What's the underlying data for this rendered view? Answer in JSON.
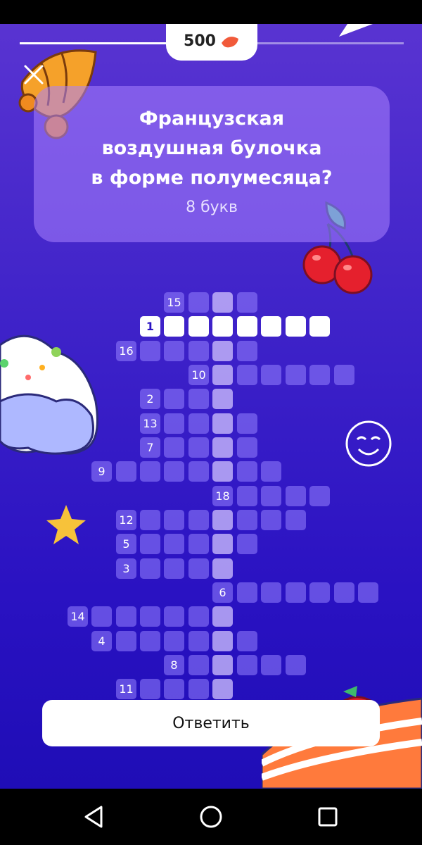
{
  "header": {
    "score": "500",
    "score_icon": "croissant-icon"
  },
  "question": {
    "text": "Французская\nвоздушная булочка\nв форме полумесяца?",
    "letters": "8 букв"
  },
  "crossword": {
    "numbers": [
      "15",
      "1",
      "16",
      "10",
      "2",
      "13",
      "7",
      "9",
      "18",
      "12",
      "5",
      "3",
      "6",
      "14",
      "4",
      "8",
      "11"
    ],
    "active_clue": "1"
  },
  "actions": {
    "answer_label": "Ответить"
  },
  "colors": {
    "background": "#3f23c9",
    "card": "#a982ff",
    "accent": "#ffffff"
  }
}
